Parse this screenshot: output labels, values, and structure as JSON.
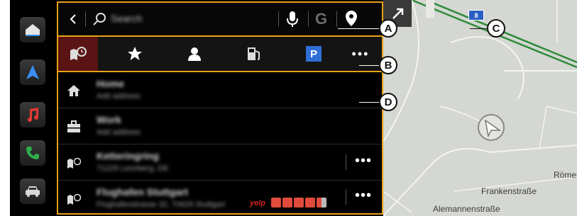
{
  "search": {
    "placeholder": "Search",
    "back_icon": "chevron-left-icon",
    "mic_icon": "microphone-icon",
    "google_glyph": "G",
    "pin_icon": "location-pin-icon"
  },
  "tabs": [
    {
      "name": "recent-destinations",
      "icon": "map-clock-icon",
      "active": true
    },
    {
      "name": "favorites",
      "icon": "star-icon"
    },
    {
      "name": "contacts",
      "icon": "person-icon"
    },
    {
      "name": "charging-stations",
      "icon": "fuel-pump-icon"
    },
    {
      "name": "parking",
      "icon": "parking-icon",
      "label": "P"
    },
    {
      "name": "more",
      "icon": "more-icon",
      "label": "•••"
    }
  ],
  "list": [
    {
      "icon": "home-icon",
      "title": "Home",
      "subtitle": "Add address"
    },
    {
      "icon": "briefcase-icon",
      "title": "Work",
      "subtitle": "Add address"
    },
    {
      "icon": "map-clock-icon",
      "title": "Ketteringring",
      "subtitle": "71229 Leonberg, DE",
      "more": "•••"
    },
    {
      "icon": "map-clock-icon",
      "title": "Flughafen Stuttgart",
      "subtitle": "Flughafenstrasse 32, 70629 Stuttgart",
      "more": "•••",
      "rating_source": "yelp",
      "stars": 4.5
    }
  ],
  "map": {
    "streets": [
      "Frankenstraße",
      "Alemannenstraße",
      "Römer"
    ],
    "road_sign": "8",
    "expand_icon": "expand-arrow-icon"
  },
  "callouts": [
    "A",
    "B",
    "C",
    "D"
  ],
  "colors": {
    "accent": "#e8a317",
    "active_tab": "#5a1414",
    "map_bg": "#d4d7d2",
    "highway": "#2e8b3a",
    "yelp_red": "#d32323"
  }
}
